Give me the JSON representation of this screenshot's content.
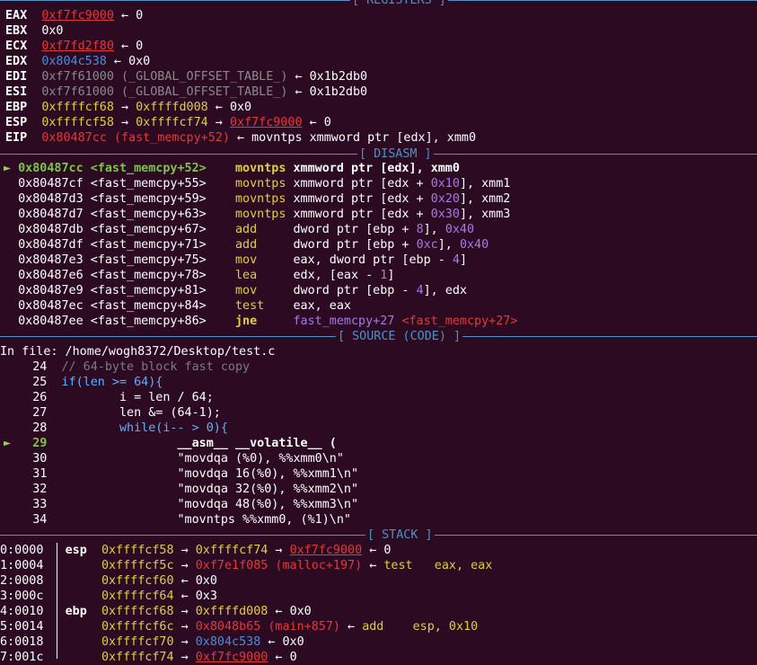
{
  "registers_header": "[ REGISTERS ]",
  "registers": [
    {
      "name": "EAX",
      "value": "0xf7fc9000",
      "arrow1": " ← ",
      "extra": "0"
    },
    {
      "name": "EBX",
      "value": "0x0"
    },
    {
      "name": "ECX",
      "value": "0xf7fd2f80",
      "arrow1": " ← ",
      "extra": "0"
    },
    {
      "name": "EDX",
      "value": "0x804c538",
      "arrow1": " ← ",
      "extra": "0x0"
    },
    {
      "name": "EDI",
      "value": "0xf7f61000",
      "sym": " (_GLOBAL_OFFSET_TABLE_)",
      "arrow1": " ← ",
      "extra": "0x1b2db0"
    },
    {
      "name": "ESI",
      "value": "0xf7f61000",
      "sym": " (_GLOBAL_OFFSET_TABLE_)",
      "arrow1": " ← ",
      "extra": "0x1b2db0"
    },
    {
      "name": "EBP",
      "value": "0xffffcf68",
      "arrow1": " → ",
      "v2": "0xffffd008",
      "arrow2": " ← ",
      "extra": "0x0"
    },
    {
      "name": "ESP",
      "value": "0xffffcf58",
      "arrow1": " → ",
      "v2": "0xffffcf74",
      "arrow2": " → ",
      "v3": "0xf7fc9000",
      "arrow3": " ← ",
      "extra": "0"
    },
    {
      "name": "EIP",
      "value": "0x80487cc",
      "sym": " (fast_memcpy+52)",
      "arrow1": " ← ",
      "instr": "movntps xmmword ptr [edx], xmm0"
    }
  ],
  "disasm_header": "[ DISASM ]",
  "disasm": [
    {
      "marker": "►",
      "addr": "0x80487cc",
      "sym": "<fast_memcpy+52>",
      "mn": "movntps",
      "op1": "xmmword ptr [edx]",
      "sep": ", ",
      "op2": "xmm0",
      "current": true
    },
    {
      "marker": "",
      "addr": "0x80487cf",
      "sym": "<fast_memcpy+55>",
      "mn": "movntps",
      "op1": "xmmword ptr [edx + ",
      "num": "0x10",
      "op1b": "], ",
      "op2": "xmm1"
    },
    {
      "marker": "",
      "addr": "0x80487d3",
      "sym": "<fast_memcpy+59>",
      "mn": "movntps",
      "op1": "xmmword ptr [edx + ",
      "num": "0x20",
      "op1b": "], ",
      "op2": "xmm2"
    },
    {
      "marker": "",
      "addr": "0x80487d7",
      "sym": "<fast_memcpy+63>",
      "mn": "movntps",
      "op1": "xmmword ptr [edx + ",
      "num": "0x30",
      "op1b": "], ",
      "op2": "xmm3"
    },
    {
      "marker": "",
      "addr": "0x80487db",
      "sym": "<fast_memcpy+67>",
      "mn": "add",
      "op1": "dword ptr [ebp + ",
      "num": "8",
      "op1b": "], ",
      "op2": "0x40"
    },
    {
      "marker": "",
      "addr": "0x80487df",
      "sym": "<fast_memcpy+71>",
      "mn": "add",
      "op1": "dword ptr [ebp + ",
      "num": "0xc",
      "op1b": "], ",
      "op2": "0x40"
    },
    {
      "marker": "",
      "addr": "0x80487e3",
      "sym": "<fast_memcpy+75>",
      "mn": "mov",
      "op1": "eax, dword ptr [ebp - ",
      "num": "4",
      "op1b": "]",
      "op2": ""
    },
    {
      "marker": "",
      "addr": "0x80487e6",
      "sym": "<fast_memcpy+78>",
      "mn": "lea",
      "op1": "edx, [eax - ",
      "num": "1",
      "op1b": "]",
      "op2": ""
    },
    {
      "marker": "",
      "addr": "0x80487e9",
      "sym": "<fast_memcpy+81>",
      "mn": "mov",
      "op1": "dword ptr [ebp - ",
      "num": "4",
      "op1b": "], ",
      "op2": "edx"
    },
    {
      "marker": "",
      "addr": "0x80487ec",
      "sym": "<fast_memcpy+84>",
      "mn": "test",
      "op1": "eax, eax",
      "num": "",
      "op1b": "",
      "op2": ""
    },
    {
      "marker": "",
      "addr": "0x80487ee",
      "sym": "<fast_memcpy+86>",
      "mn": "jne",
      "op1": "fast_memcpy+27 ",
      "num": "",
      "op1b": "",
      "op2": "<fast_memcpy+27>",
      "jump": true
    }
  ],
  "source_header": "[ SOURCE (CODE) ]",
  "source_file": "In file: /home/wogh8372/Desktop/test.c",
  "source": [
    {
      "n": "24",
      "code": "  // 64-byte block fast copy"
    },
    {
      "n": "25",
      "code": "  if(len >= 64){"
    },
    {
      "n": "26",
      "code": "          i = len / 64;"
    },
    {
      "n": "27",
      "code": "          len &= (64-1);"
    },
    {
      "n": "28",
      "code": "          while(i-- > 0){"
    },
    {
      "n": "29",
      "code": "                  __asm__ __volatile__ (",
      "current": true
    },
    {
      "n": "30",
      "code": "                  \"movdqa (%0), %%xmm0\\n\""
    },
    {
      "n": "31",
      "code": "                  \"movdqa 16(%0), %%xmm1\\n\""
    },
    {
      "n": "32",
      "code": "                  \"movdqa 32(%0), %%xmm2\\n\""
    },
    {
      "n": "33",
      "code": "                  \"movdqa 48(%0), %%xmm3\\n\""
    },
    {
      "n": "34",
      "code": "                  \"movntps %%xmm0, (%1)\\n\""
    }
  ],
  "stack_header": "[ STACK ]",
  "stack": [
    {
      "off": "00:0000",
      "reg": "esp",
      "addr": "0xffffcf58",
      "a1": " → ",
      "v1": "0xffffcf74",
      "a2": " → ",
      "v2": "0xf7fc9000",
      "a3": " ← ",
      "v3": "0"
    },
    {
      "off": "01:0004",
      "reg": "",
      "addr": "0xffffcf5c",
      "a1": " → ",
      "v1": "0xf7e1f085 (malloc+197)",
      "a2": " ← ",
      "v2": "test   eax, eax"
    },
    {
      "off": "02:0008",
      "reg": "",
      "addr": "0xffffcf60",
      "a1": " ← ",
      "v1": "0x0"
    },
    {
      "off": "03:000c",
      "reg": "",
      "addr": "0xffffcf64",
      "a1": " ← ",
      "v1": "0x3"
    },
    {
      "off": "04:0010",
      "reg": "ebp",
      "addr": "0xffffcf68",
      "a1": " → ",
      "v1": "0xffffd008",
      "a2": " ← ",
      "v2": "0x0"
    },
    {
      "off": "05:0014",
      "reg": "",
      "addr": "0xffffcf6c",
      "a1": " → ",
      "v1": "0x8048b65 (main+857)",
      "a2": " ← ",
      "v2": "add    esp, 0x10"
    },
    {
      "off": "06:0018",
      "reg": "",
      "addr": "0xffffcf70",
      "a1": " → ",
      "v1": "0x804c538",
      "a2": " ← ",
      "v2": "0x0"
    },
    {
      "off": "07:001c",
      "reg": "",
      "addr": "0xffffcf74",
      "a1": " → ",
      "v1": "0xf7fc9000",
      "a2": " ← ",
      "v2": "0"
    }
  ]
}
